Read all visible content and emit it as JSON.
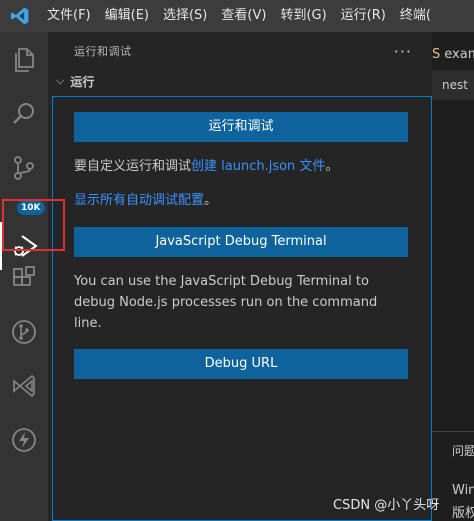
{
  "menubar": {
    "items": [
      "文件(F)",
      "编辑(E)",
      "选择(S)",
      "查看(V)",
      "转到(G)",
      "运行(R)",
      "终端("
    ]
  },
  "activitybar": {
    "items": [
      {
        "icon": "files-icon"
      },
      {
        "icon": "search-icon"
      },
      {
        "icon": "source-control-icon",
        "badge": "10K"
      },
      {
        "icon": "run-debug-icon",
        "active": true
      },
      {
        "icon": "extensions-icon"
      },
      {
        "icon": "git-graph-icon"
      },
      {
        "icon": "visual-studio-icon"
      },
      {
        "icon": "lightning-icon"
      }
    ]
  },
  "sidebar": {
    "title": "运行和调试",
    "more": "···",
    "section_title": "运行",
    "run_button": "运行和调试",
    "customize_text": "要自定义运行和调试",
    "create_link": "创建 launch.json 文件",
    "period": "。",
    "show_all_link": "显示所有自动调试配置",
    "period2": "。",
    "js_terminal_button": "JavaScript Debug Terminal",
    "js_terminal_desc": "You can use the JavaScript Debug Terminal to debug Node.js processes run on the command line.",
    "debug_url_button": "Debug URL"
  },
  "editor": {
    "tab_symbol": "S",
    "tab_label": "exam",
    "tab2_label": "nest",
    "panel_tab": "问题",
    "terminal_line1": "Win",
    "terminal_line2": "版权"
  },
  "watermark": "CSDN @小丫头呀",
  "colors": {
    "accent": "#0e639c",
    "link": "#3794ff",
    "highlight": "#e03131"
  }
}
